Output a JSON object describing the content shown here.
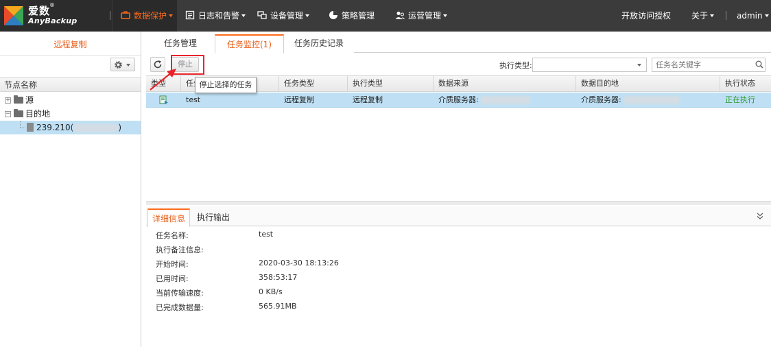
{
  "app": {
    "logo_cn": "爱数",
    "logo_reg": "®",
    "logo_en": "AnyBackup"
  },
  "nav": {
    "items": [
      {
        "label": "数据保护",
        "icon": "briefcase-icon",
        "active": true
      },
      {
        "label": "日志和告警",
        "icon": "log-icon"
      },
      {
        "label": "设备管理",
        "icon": "device-icon"
      },
      {
        "label": "策略管理",
        "icon": "policy-icon"
      },
      {
        "label": "运营管理",
        "icon": "users-icon"
      }
    ],
    "open_access": "开放访问授权",
    "about": "关于",
    "user": "admin"
  },
  "left": {
    "title": "远程复制",
    "tree_header": "节点名称",
    "tree": [
      {
        "label": "源",
        "toggle": "+"
      },
      {
        "label": "目的地",
        "toggle": "−"
      },
      {
        "label_prefix": "239.210(",
        "label_suffix": ")",
        "selected": true
      }
    ]
  },
  "tabs": [
    {
      "label": "任务管理"
    },
    {
      "label": "任务监控(1)",
      "active": true
    },
    {
      "label": "任务历史记录"
    }
  ],
  "toolbar": {
    "stop_label": "停止",
    "exec_type_label": "执行类型:",
    "exec_type_value": "",
    "search_placeholder": "任务名关键字"
  },
  "tooltip": "停止选择的任务",
  "table": {
    "columns": [
      "类型",
      "任务",
      "任务类型",
      "执行类型",
      "数据来源",
      "数据目的地",
      "执行状态"
    ],
    "rows": [
      {
        "icon": "task-copy-icon",
        "name": "test",
        "task_type": "远程复制",
        "exec_type": "远程复制",
        "source": "介质服务器:",
        "destination": "介质服务器:",
        "status": "正在执行"
      }
    ]
  },
  "details": {
    "tabs": [
      {
        "label": "详细信息",
        "active": true
      },
      {
        "label": "执行输出"
      }
    ],
    "fields": [
      {
        "label": "任务名称:",
        "value": "test"
      },
      {
        "label": "执行备注信息:",
        "value": ""
      },
      {
        "label": "开始时间:",
        "value": "2020-03-30 18:13:26"
      },
      {
        "label": "已用时间:",
        "value": "358:53:17"
      },
      {
        "label": "当前传输速度:",
        "value": "0 KB/s"
      },
      {
        "label": "已完成数据量:",
        "value": "565.91MB"
      }
    ]
  },
  "colors": {
    "accent": "#ff6a1a",
    "running": "#2a9a2a",
    "selection": "#bfe0f4",
    "highlight": "#e8232b"
  }
}
